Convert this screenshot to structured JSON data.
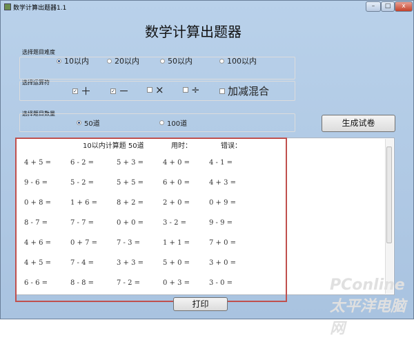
{
  "window": {
    "title": "数学计算出题器1.1",
    "minimize": "–",
    "maximize": "□",
    "close": "x"
  },
  "heading": "数学计算出题器",
  "difficulty": {
    "label": "选择题目难度",
    "options": [
      {
        "label": "10以内",
        "checked": true
      },
      {
        "label": "20以内",
        "checked": false
      },
      {
        "label": "50以内",
        "checked": false
      },
      {
        "label": "100以内",
        "checked": false
      }
    ]
  },
  "operators": {
    "label": "选择运算符",
    "options": [
      {
        "label": "＋",
        "checked": true
      },
      {
        "label": "－",
        "checked": true
      },
      {
        "label": "×",
        "checked": false
      },
      {
        "label": "÷",
        "checked": false
      },
      {
        "label": "加减混合",
        "checked": false
      }
    ]
  },
  "count": {
    "label": "选择题目数量",
    "options": [
      {
        "label": "50道",
        "checked": true
      },
      {
        "label": "100道",
        "checked": false
      }
    ]
  },
  "generate_button": "生成试卷",
  "sheet": {
    "title": "10以内计算题 50道",
    "time_label": "用时：",
    "error_label": "错误：",
    "rows": [
      [
        "4 + 5 =",
        "6 - 2 =",
        "5 + 3 =",
        "4 + 0 =",
        "4 - 1 ="
      ],
      [
        "9 - 6 =",
        "5 - 2 =",
        "5 + 5 =",
        "6 + 0 =",
        "4 + 3 ="
      ],
      [
        "0 + 8 =",
        "1 + 6 =",
        "8 + 2 =",
        "2 + 0 =",
        "0 + 9 ="
      ],
      [
        "8 - 7 =",
        "7 - 7 =",
        "0 + 0 =",
        "3 - 2 =",
        "9 - 9 ="
      ],
      [
        "4 + 6 =",
        "0 + 7 =",
        "7 - 3 =",
        "1 + 1 =",
        "7 + 0 ="
      ],
      [
        "4 + 5 =",
        "7 - 4 =",
        "3 + 3 =",
        "5 + 0 =",
        "3 + 0 ="
      ],
      [
        "6 - 6 =",
        "8 - 8 =",
        "7 - 2 =",
        "0 + 3 =",
        "3 - 0 ="
      ]
    ]
  },
  "print_button": "打印",
  "watermark": "PConline 太平洋电脑网"
}
